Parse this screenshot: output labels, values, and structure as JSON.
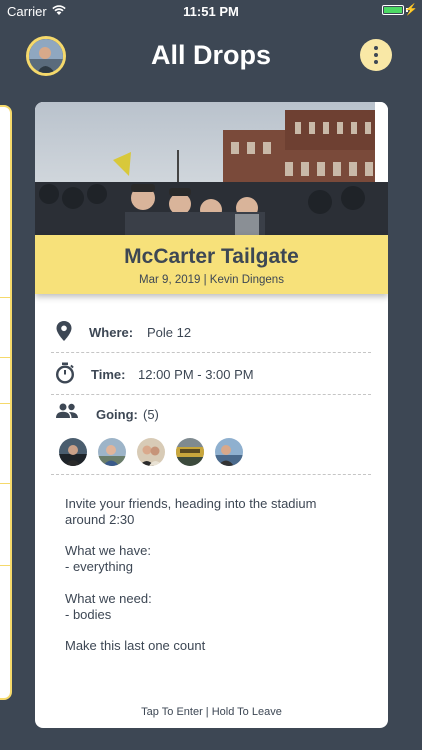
{
  "status_bar": {
    "carrier": "Carrier",
    "time": "11:51 PM"
  },
  "header": {
    "title": "All Drops"
  },
  "event": {
    "title": "McCarter Tailgate",
    "subtitle": "Mar 9, 2019 | Kevin Dingens",
    "where_label": "Where:",
    "where_value": "Pole 12",
    "time_label": "Time:",
    "time_value": "12:00 PM - 3:00 PM",
    "going_label": "Going:",
    "going_count": "(5)",
    "description": [
      "Invite your friends, heading into the stadium",
      "around 2:30",
      "What we have:",
      "- everything",
      "What we need:",
      "- bodies",
      "Make this last one count"
    ],
    "footer": "Tap To Enter | Hold To Leave"
  },
  "colors": {
    "background": "#3d4754",
    "accent": "#f7e17a",
    "card": "#ffffff"
  }
}
